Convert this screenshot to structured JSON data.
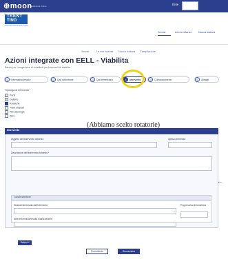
{
  "topbar": {
    "logo": "⊕moon",
    "logo_subtitle": "Modulistica Online",
    "user_label": "Ente"
  },
  "brand": {
    "line1": "TRENT",
    "line2": "TINO",
    "subtitle": "Provincia autonoma di Trento"
  },
  "top_nav": [
    "Servizi",
    "Le mie istanze",
    "Nuova istanza"
  ],
  "breadcrumb": [
    "Servizi",
    "Le mie istanze",
    "Nuova istanza",
    "Compilazione"
  ],
  "page": {
    "title": "Azioni integrate con EELL - Viabilita",
    "description": "Bando per l'erogazione di contributi per interventi di viabilita"
  },
  "stepper": [
    {
      "number": "1",
      "label": "Informativa privacy"
    },
    {
      "number": "2",
      "label": "Dati richiedente"
    },
    {
      "number": "3",
      "label": "Dati beneficiario"
    },
    {
      "number": "4",
      "label": "Intervento"
    },
    {
      "number": "5",
      "label": "Cofinanziamento"
    },
    {
      "number": "6",
      "label": "Allegati"
    }
  ],
  "categories": {
    "title": "Tipologia di intervento *",
    "items": [
      {
        "label": "Ponti",
        "checked": false
      },
      {
        "label": "Gallerie",
        "checked": false
      },
      {
        "label": "Rotatorie",
        "checked": true
      },
      {
        "label": "Tratti stradali",
        "checked": false
      },
      {
        "label": "Altre tipologie",
        "checked": false
      },
      {
        "label": "Altro",
        "checked": false
      }
    ]
  },
  "annotation": "(Abbiamo scelto rotatorie)",
  "form": {
    "panel_title": "Intervento",
    "subject_label": "Oggetto dell'intervento richiesto",
    "cost_label": "Spesa ammessa",
    "description_label": "Descrizione dell'intervento richiesto *",
    "location_title": "Localizzazione",
    "road_label": "Strada interessata dall'intervento",
    "progressive_label": "Progressiva chilometrica",
    "notes_label": "Altre informazioni sulla localizzazione"
  },
  "buttons": {
    "save_draft": "Salva in bozza",
    "previous": "Precedente",
    "next": "Successivo"
  },
  "colors": {
    "primary": "#2b3f8c",
    "highlight": "#f0d21a"
  }
}
